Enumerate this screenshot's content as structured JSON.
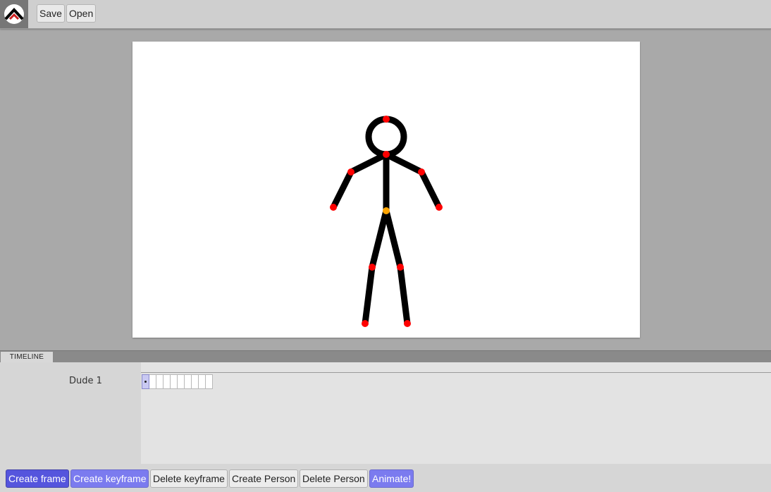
{
  "toolbar": {
    "logo_icon": "pivot-logo-icon",
    "save_label": "Save",
    "open_label": "Open"
  },
  "canvas": {
    "figure_icon": "stick-figure",
    "joint_color": "#ff0000",
    "root_joint_color": "#ffa500",
    "limb_color": "#000000"
  },
  "timeline": {
    "tab_label": "TIMELINE",
    "people": [
      {
        "name": "Dude 1",
        "frame_count": 10,
        "active_frame": 1
      }
    ]
  },
  "actions": {
    "create_frame": "Create frame",
    "create_keyframe": "Create keyframe",
    "delete_keyframe": "Delete keyframe",
    "create_person": "Create Person",
    "delete_person": "Delete Person",
    "animate": "Animate!"
  },
  "colors": {
    "primary_button": "#5555dd",
    "secondary_button": "#7b7bef",
    "background": "#a9a9a9"
  }
}
